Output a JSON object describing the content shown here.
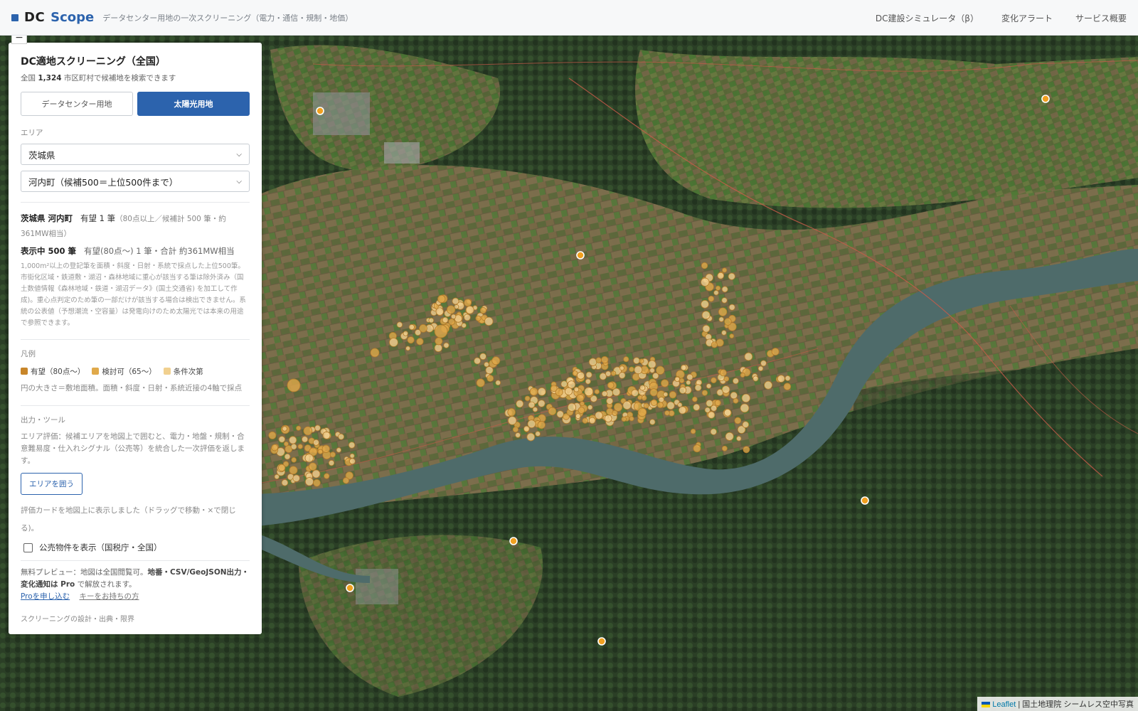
{
  "header": {
    "logo_dc": "DC",
    "logo_scope": "Scope",
    "tagline": "データセンター用地の一次スクリーニング（電力・通信・規制・地価）",
    "nav": [
      "DC建設シミュレータ（β）",
      "変化アラート",
      "サービス概要"
    ]
  },
  "panel": {
    "title": "DC適地スクリーニング（全国）",
    "subtitle_prefix": "全国 ",
    "subtitle_count": "1,324",
    "subtitle_suffix": " 市区町村で候補地を検索できます",
    "mode_tabs": [
      {
        "label": "データセンター用地",
        "active": false
      },
      {
        "label": "太陽光用地",
        "active": true
      }
    ],
    "area_label": "エリア",
    "prefecture_value": "茨城県",
    "municipality_value": "河内町（候補500＝上位500件まで）",
    "result_region": "茨城県 河内町",
    "result_promising": "有望 1 筆",
    "result_detail": "（80点以上／候補計 500 筆・約 361MW相当）",
    "display_count": "表示中 500 筆",
    "display_detail": "有望(80点〜) 1 筆・合計 約361MW相当",
    "method_note": "1,000m²以上の登記筆を面積・斜度・日射・系統で採点した上位500筆。市街化区域・鉄道敷・湖沼・森林地域に重心が該当する筆は除外済み（国土数値情報《森林地域・鉄道・湖沼データ》(国土交通省) を加工して作成)。重心点判定のため筆の一部だけが該当する場合は検出できません。系統の公表値（予想潮流・空容量）は発電向けのため太陽光では本来の用途で参照できます。",
    "legend_label": "凡例",
    "legend_items": [
      {
        "label": "有望（80点〜）",
        "color": "#c8862a"
      },
      {
        "label": "検討可（65〜）",
        "color": "#e0a94a"
      },
      {
        "label": "条件次第",
        "color": "#f1d08f"
      }
    ],
    "legend_note": "円の大きさ＝敷地面積。面積・斜度・日射・系統近接の4軸で採点",
    "tools_label": "出力・ツール",
    "tools_text": "エリア評価：候補エリアを地図上で囲むと、電力・地盤・規制・合意難易度・仕入れシグナル（公売等）を統合した一次評価を返します。",
    "enclose_button": "エリアを囲う",
    "card_note": "評価カードを地図上に表示しました（ドラッグで移動・×で閉じる)。",
    "public_sale_label": "公売物件を表示（国税庁・全国）",
    "promo_prefix": "無料プレビュー：地図は全国閲覧可。",
    "promo_bold": "地番・CSV/GeoJSON出力・変化通知は Pro",
    "promo_suffix": " で解放されます。",
    "pro_link": "Proを申し込む",
    "key_link": "キーをお持ちの方",
    "footer_link": "スクリーニングの設計・出典・限界"
  },
  "map": {
    "zoom_out": "−",
    "attribution_leaflet": "Leaflet",
    "attribution_source": " | 国土地理院 シームレス空中写真",
    "colors": {
      "promising": "#c8862a",
      "candidate": "#e0a94a",
      "conditional": "#f1d08f",
      "river": "#4e6b6a",
      "road": "#c95b4a"
    }
  }
}
